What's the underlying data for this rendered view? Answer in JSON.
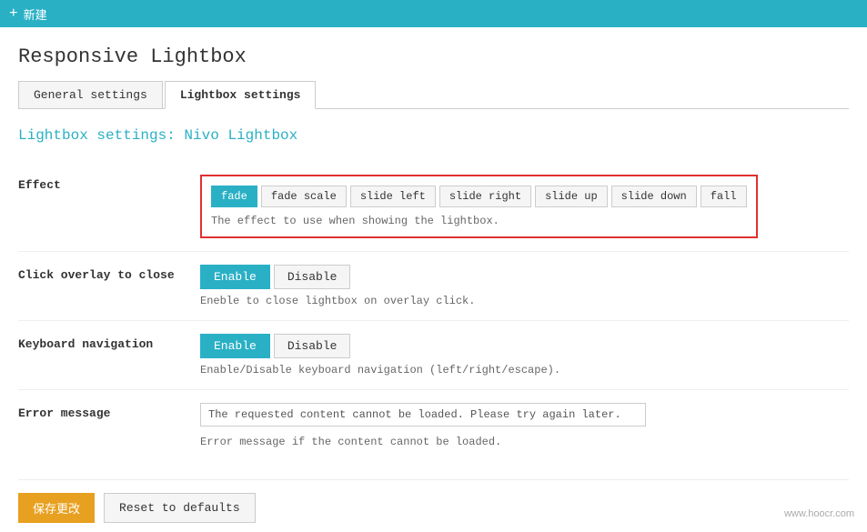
{
  "topbar": {
    "icon": "+",
    "label": "新建"
  },
  "page": {
    "title": "Responsive Lightbox"
  },
  "tabs": [
    {
      "id": "general",
      "label": "General settings",
      "active": false
    },
    {
      "id": "lightbox",
      "label": "Lightbox settings",
      "active": true
    }
  ],
  "section": {
    "title": "Lightbox settings: Nivo Lightbox"
  },
  "effect": {
    "label": "Effect",
    "buttons": [
      "fade",
      "fade scale",
      "slide left",
      "slide right",
      "slide up",
      "slide down",
      "fall"
    ],
    "active": "fade",
    "help": "The effect to use when showing the lightbox."
  },
  "clickOverlay": {
    "label": "Click overlay to close",
    "options": [
      "Enable",
      "Disable"
    ],
    "active": "Enable",
    "help": "Eneble to close lightbox on overlay click."
  },
  "keyboardNav": {
    "label": "Keyboard navigation",
    "options": [
      "Enable",
      "Disable"
    ],
    "active": "Enable",
    "help": "Enable/Disable keyboard navigation (left/right/escape)."
  },
  "errorMessage": {
    "label": "Error message",
    "value": "The requested content cannot be loaded. Please try again later.",
    "help": "Error message if the content cannot be loaded."
  },
  "footer": {
    "save_label": "保存更改",
    "reset_label": "Reset to defaults"
  },
  "watermark": "www.hoocr.com"
}
